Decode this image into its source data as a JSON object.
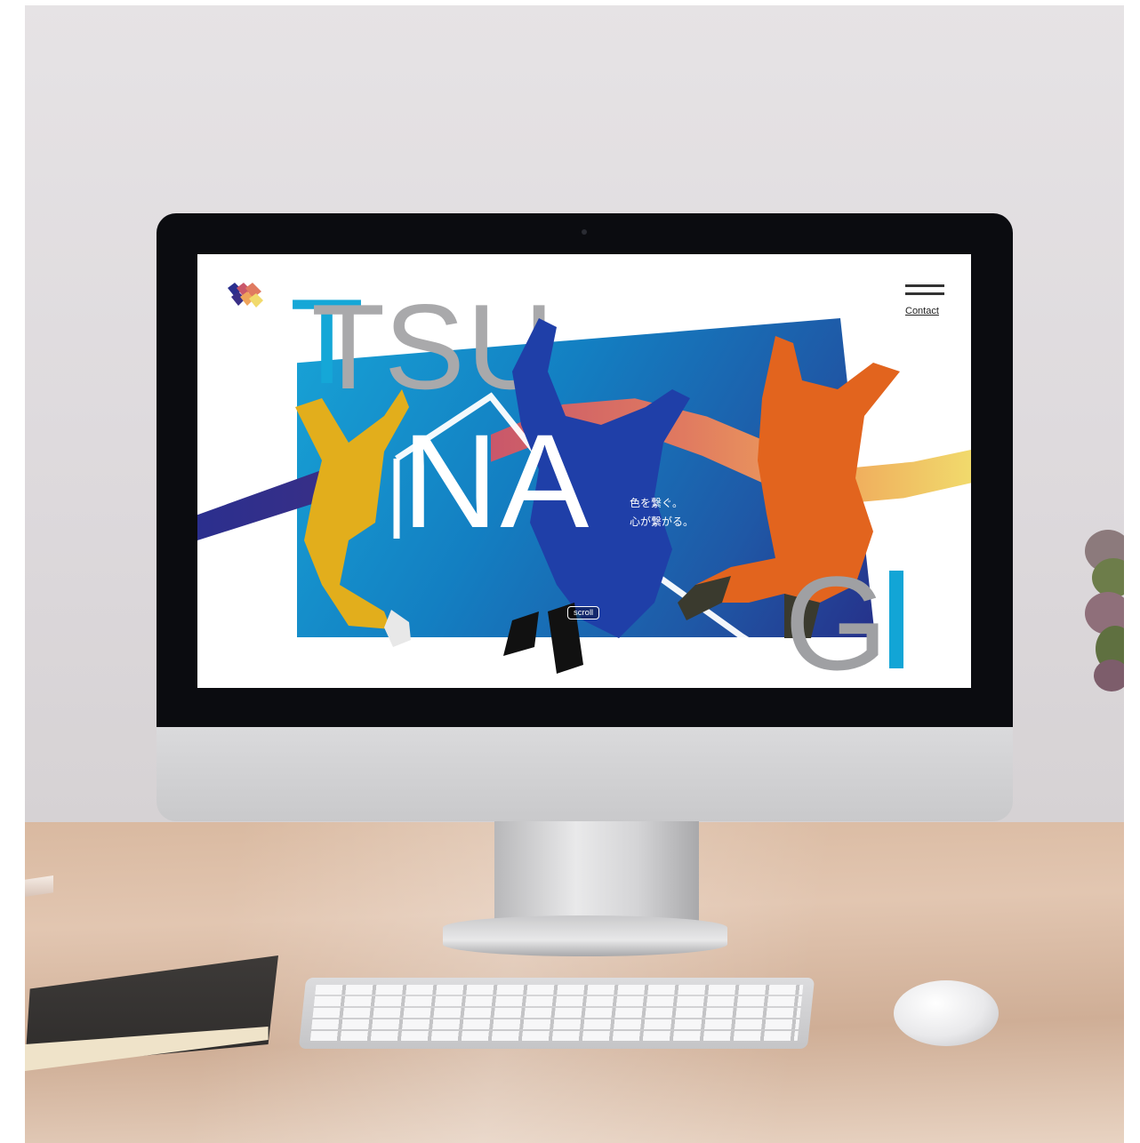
{
  "site": {
    "title_letters": {
      "t": "T",
      "su": "SU",
      "na": "NA",
      "g": "G"
    },
    "nav": {
      "contact_label": "Contact"
    },
    "tagline": {
      "line1": "色を繋ぐ。",
      "line2": "心が繋がる。"
    },
    "scroll_label": "scroll"
  },
  "colors": {
    "accent_cyan": "#15a7d7",
    "letter_gray": "#a9a9ab",
    "panel_blue": "#137fc2",
    "wave_warm": "#e07a60",
    "wave_yellow": "#f1da6c",
    "jumpsuit_yellow": "#e2ae1c",
    "jumpsuit_blue": "#1f3fa8",
    "jumpsuit_orange": "#e2641e"
  },
  "icons": {
    "logo": "tsunagi-logo-icon",
    "menu": "hamburger-menu-icon"
  }
}
